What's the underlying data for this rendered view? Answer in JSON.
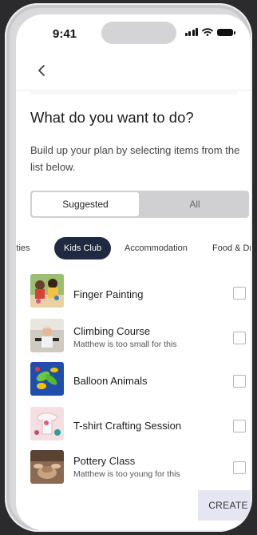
{
  "status": {
    "time": "9:41"
  },
  "header": {
    "title": "What do you want to do?",
    "subtitle": "Build up your plan by selecting items from the list below."
  },
  "segments": [
    {
      "label": "Suggested",
      "active": true
    },
    {
      "label": "All",
      "active": false
    }
  ],
  "chips": [
    "ivities",
    "Kids Club",
    "Accommodation",
    "Food & Dri"
  ],
  "selected_chip": "Kids Club",
  "items": [
    {
      "title": "Finger Painting",
      "note": "",
      "checked": false,
      "image": "children-painting"
    },
    {
      "title": "Climbing Course",
      "note": "Matthew is too small for this",
      "checked": false,
      "image": "child-climbing"
    },
    {
      "title": "Balloon Animals",
      "note": "",
      "checked": false,
      "image": "balloon-animal"
    },
    {
      "title": "T-shirt Crafting Session",
      "note": "",
      "checked": false,
      "image": "tshirt-craft"
    },
    {
      "title": "Pottery Class",
      "note": "Matthew is too young for this",
      "checked": false,
      "image": "pottery"
    }
  ],
  "actions": {
    "create_label": "CREATE"
  },
  "colors": {
    "chip_active": "#1f2a40",
    "create_bg": "#e6e6f2",
    "segment_track": "#d0d0d3"
  },
  "icons": {
    "back": "chevron-left-icon",
    "signal": "signal-icon",
    "wifi": "wifi-icon",
    "battery": "battery-icon"
  }
}
